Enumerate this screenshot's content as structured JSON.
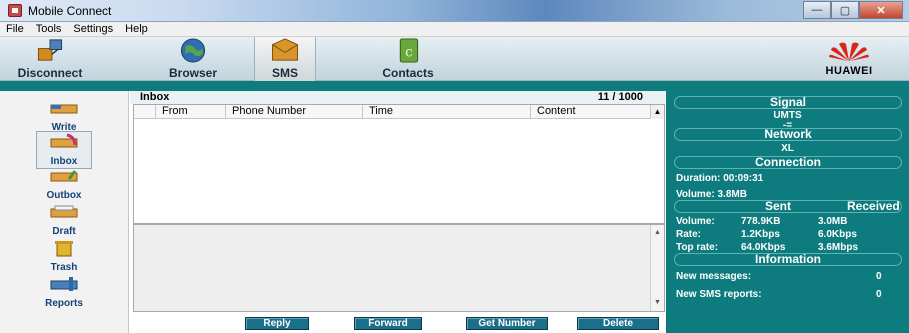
{
  "window": {
    "title": "Mobile Connect",
    "minimize": "—",
    "maximize": "▢",
    "close": "✕"
  },
  "menu": [
    "File",
    "Tools",
    "Settings",
    "Help"
  ],
  "toolbar": {
    "disconnect": "Disconnect",
    "browser": "Browser",
    "sms": "SMS",
    "contacts": "Contacts",
    "brand": "HUAWEI"
  },
  "nav": {
    "write": "Write",
    "inbox": "Inbox",
    "outbox": "Outbox",
    "draft": "Draft",
    "trash": "Trash",
    "reports": "Reports"
  },
  "inbox": {
    "title": "Inbox",
    "count": "11 / 1000",
    "columns": [
      "From",
      "Phone Number",
      "Time",
      "Content"
    ]
  },
  "actions": {
    "reply": "Reply",
    "forward": "Forward",
    "get_number": "Get Number",
    "delete": "Delete"
  },
  "status": {
    "signal_head": "Signal",
    "signal_type": "UMTS",
    "signal_sub": "-=",
    "network_head": "Network",
    "network_name": "XL",
    "connection_head": "Connection",
    "duration": "Duration: 00:09:31",
    "volume": "Volume:  3.8MB",
    "sent_head": "Sent",
    "received_head": "Received",
    "vol_label": "Volume:",
    "vol_sent": "778.9KB",
    "vol_recv": "3.0MB",
    "rate_label": "Rate:",
    "rate_sent": "1.2Kbps",
    "rate_recv": "6.0Kbps",
    "top_label": "Top rate:",
    "top_sent": "64.0Kbps",
    "top_recv": "3.6Mbps",
    "info_head": "Information",
    "new_messages_label": "New messages:",
    "new_messages_value": "0",
    "new_reports_label": "New SMS reports:",
    "new_reports_value": "0"
  },
  "colors": {
    "teal": "#0e7c7e",
    "button": "#1a6f8a",
    "nav_text": "#15417a"
  }
}
